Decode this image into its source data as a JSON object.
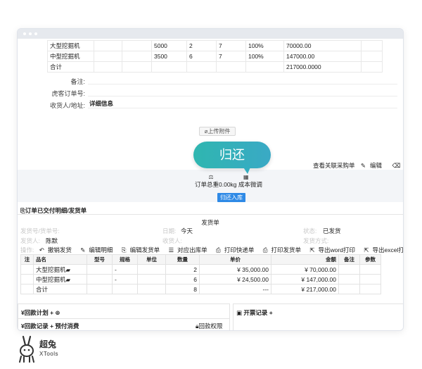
{
  "goods_top": {
    "rows": [
      {
        "name": "大型挖掘机",
        "price": "5000",
        "qty": "2",
        "days": "7",
        "rate": "100%",
        "amount": "70000.00"
      },
      {
        "name": "中型挖掘机",
        "price": "3500",
        "qty": "6",
        "days": "7",
        "rate": "100%",
        "amount": "147000.00"
      }
    ],
    "total_label": "合计",
    "total_amount": "217000.0000"
  },
  "form": {
    "remark_label": "备注:",
    "customer_order_label": "虎客订单号:",
    "receiver_label": "收货人/地址:",
    "receiver_value": "详细信息",
    "upload_label": "上传附件"
  },
  "callout": {
    "text": "归还"
  },
  "actions": {
    "view_purchase": "查看关联采购单",
    "edit": "编辑",
    "delete": "删"
  },
  "summary": {
    "weight_label": "订单总重0.00kg",
    "cost_label": "成本微调",
    "return_button": "归还入库"
  },
  "shipping": {
    "section_title": "订单已交付明细/发货单",
    "doc_title": "发货单",
    "ship_no_label": "发货号/货单号:",
    "date_label": "日期:",
    "date_value": "今天",
    "status_label": "状态:",
    "status_value": "已发货",
    "shipper_label": "发货人:",
    "shipper_value": "陈默",
    "receiver_label": "收货人:",
    "ship_method_label": "发货方式:",
    "ops_label": "操作:",
    "ops": [
      "撤销发货",
      "编辑明细",
      "编辑发货单",
      "对应出库单",
      "打印快递单",
      "打印发货单",
      "导出word打印",
      "导出excel打印"
    ],
    "columns": [
      "注",
      "品名",
      "型号",
      "规格",
      "单位",
      "数量",
      "单价",
      "金额",
      "备注",
      "参数"
    ],
    "rows": [
      {
        "name": "大型挖掘机",
        "model": "-",
        "qty": "2",
        "price": "¥ 35,000.00",
        "amount": "¥ 70,000.00"
      },
      {
        "name": "中型挖掘机",
        "model": "-",
        "qty": "6",
        "price": "¥ 24,500.00",
        "amount": "¥ 147,000.00"
      }
    ],
    "total_label": "合计",
    "total_qty": "8",
    "total_price": "---",
    "total_amount": "¥ 217,000.00"
  },
  "bottom": {
    "payment_plan": "¥回款计划 + ⊕",
    "invoice_records": "开票记录 +",
    "payment_records": "¥回款记录 + 预付消费",
    "payment_permission": "回款权限"
  },
  "brand": {
    "name": "超兔",
    "sub": "XTools"
  }
}
